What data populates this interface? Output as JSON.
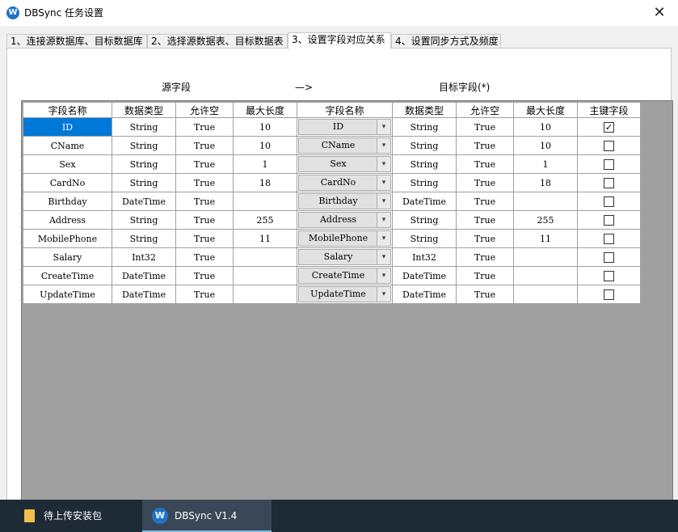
{
  "window": {
    "title": "DBSync 任务设置",
    "icon_name": "dbsync-app-icon",
    "close_glyph": "✕"
  },
  "tabs": [
    {
      "label": "1、连接源数据库、目标数据库",
      "active": false
    },
    {
      "label": "2、选择源数据表、目标数据表",
      "active": false
    },
    {
      "label": "3、设置字段对应关系",
      "active": true
    },
    {
      "label": "4、设置同步方式及频度",
      "active": false
    }
  ],
  "mapping_header": {
    "source_label": "源字段",
    "arrow": "—>",
    "target_label": "目标字段(*)"
  },
  "grid": {
    "columns": [
      "字段名称",
      "数据类型",
      "允许空",
      "最大长度",
      "字段名称",
      "数据类型",
      "允许空",
      "最大长度",
      "主键字段"
    ],
    "rows": [
      {
        "src_name": "ID",
        "src_type": "String",
        "src_null": "True",
        "src_len": "10",
        "dst_name": "ID",
        "dst_type": "String",
        "dst_null": "True",
        "dst_len": "10",
        "pk": true
      },
      {
        "src_name": "CName",
        "src_type": "String",
        "src_null": "True",
        "src_len": "10",
        "dst_name": "CName",
        "dst_type": "String",
        "dst_null": "True",
        "dst_len": "10",
        "pk": false
      },
      {
        "src_name": "Sex",
        "src_type": "String",
        "src_null": "True",
        "src_len": "1",
        "dst_name": "Sex",
        "dst_type": "String",
        "dst_null": "True",
        "dst_len": "1",
        "pk": false
      },
      {
        "src_name": "CardNo",
        "src_type": "String",
        "src_null": "True",
        "src_len": "18",
        "dst_name": "CardNo",
        "dst_type": "String",
        "dst_null": "True",
        "dst_len": "18",
        "pk": false
      },
      {
        "src_name": "Birthday",
        "src_type": "DateTime",
        "src_null": "True",
        "src_len": "",
        "dst_name": "Birthday",
        "dst_type": "DateTime",
        "dst_null": "True",
        "dst_len": "",
        "pk": false
      },
      {
        "src_name": "Address",
        "src_type": "String",
        "src_null": "True",
        "src_len": "255",
        "dst_name": "Address",
        "dst_type": "String",
        "dst_null": "True",
        "dst_len": "255",
        "pk": false
      },
      {
        "src_name": "MobilePhone",
        "src_type": "String",
        "src_null": "True",
        "src_len": "11",
        "dst_name": "MobilePhone",
        "dst_type": "String",
        "dst_null": "True",
        "dst_len": "11",
        "pk": false
      },
      {
        "src_name": "Salary",
        "src_type": "Int32",
        "src_null": "True",
        "src_len": "",
        "dst_name": "Salary",
        "dst_type": "Int32",
        "dst_null": "True",
        "dst_len": "",
        "pk": false
      },
      {
        "src_name": "CreateTime",
        "src_type": "DateTime",
        "src_null": "True",
        "src_len": "",
        "dst_name": "CreateTime",
        "dst_type": "DateTime",
        "dst_null": "True",
        "dst_len": "",
        "pk": false
      },
      {
        "src_name": "UpdateTime",
        "src_type": "DateTime",
        "src_null": "True",
        "src_len": "",
        "dst_name": "UpdateTime",
        "dst_type": "DateTime",
        "dst_null": "True",
        "dst_len": "",
        "pk": false
      }
    ],
    "selected_cell": "ID",
    "selection_color": "#0078d7"
  },
  "taskbar": {
    "items": [
      {
        "label": "待上传安装包",
        "icon": "folder-icon",
        "active": false
      },
      {
        "label": "DBSync V1.4",
        "icon": "dbsync-app-icon",
        "active": true
      }
    ],
    "background": "#1e2a36"
  },
  "icons": {
    "dropdown": "▾",
    "check": "✓"
  }
}
